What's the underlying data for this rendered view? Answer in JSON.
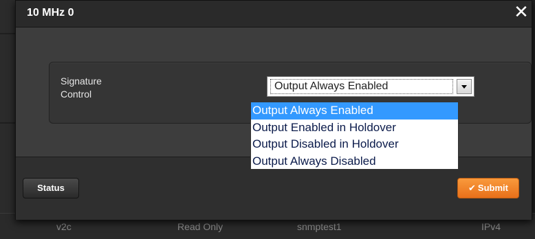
{
  "modal": {
    "title": "10 MHz 0",
    "close_glyph": "✕"
  },
  "form": {
    "field_label_line1": "Signature",
    "field_label_line2": "Control",
    "select": {
      "selected": "Output Always Enabled",
      "options": [
        "Output Always Enabled",
        "Output Enabled in Holdover",
        "Output Disabled in Holdover",
        "Output Always Disabled"
      ]
    }
  },
  "footer": {
    "status_label": "Status",
    "submit_label": "Submit",
    "submit_icon": "check-icon"
  },
  "background_row": {
    "cells": [
      "v2c",
      "Read Only",
      "snmptest1",
      "IPv4"
    ]
  },
  "colors": {
    "accent_orange": "#f08a2c",
    "selection_blue": "#3399ff"
  }
}
